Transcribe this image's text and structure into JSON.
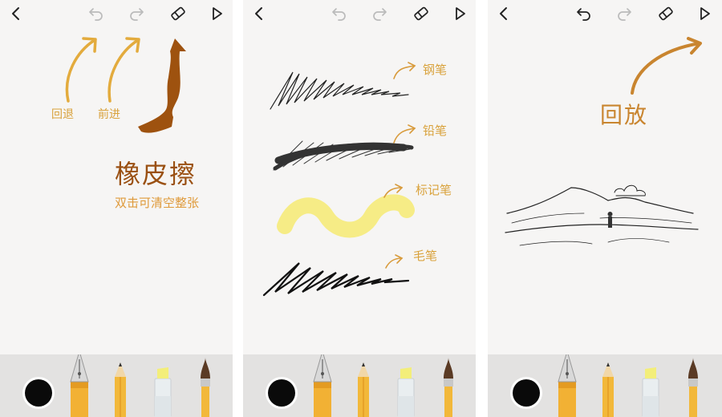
{
  "panels": [
    {
      "id": "controls",
      "annotations": {
        "undo_label": "回退",
        "redo_label": "前进",
        "eraser_title": "橡皮擦",
        "eraser_hint": "双击可清空整张"
      },
      "toolbar": {
        "undo_enabled": false,
        "redo_enabled": false
      }
    },
    {
      "id": "brushes",
      "annotations": {
        "pen_label": "钢笔",
        "pencil_label": "铅笔",
        "marker_label": "标记笔",
        "brush_label": "毛笔"
      },
      "toolbar": {
        "undo_enabled": false,
        "redo_enabled": false
      }
    },
    {
      "id": "playback",
      "annotations": {
        "playback_label": "回放"
      },
      "toolbar": {
        "undo_enabled": true,
        "redo_enabled": false
      }
    }
  ],
  "tools": [
    "color-swatch",
    "fountain-pen",
    "pencil",
    "marker",
    "paint-brush"
  ],
  "toolbar_icons": [
    "back-icon",
    "undo-icon",
    "redo-icon",
    "eraser-icon",
    "play-icon"
  ],
  "colors": {
    "background": "#f6f5f4",
    "tray": "#e3e2e1",
    "annotation_gold": "#e0a93a",
    "annotation_brown": "#9a5012",
    "icon_active": "#222222",
    "icon_disabled": "#b8b8b8",
    "marker_yellow": "#f6ec86",
    "swatch": "#0a0a0a"
  }
}
